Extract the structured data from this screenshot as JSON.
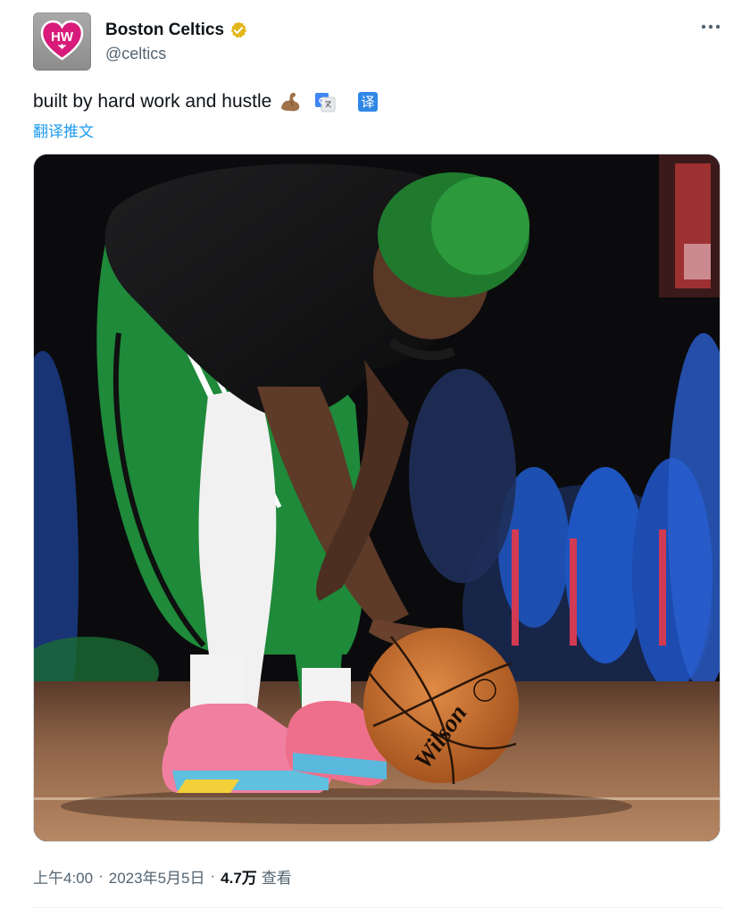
{
  "author": {
    "display_name": "Boston Celtics",
    "handle": "@celtics",
    "avatar_text": "HW",
    "verified_color": "#e2b719"
  },
  "tweet": {
    "text": "built by hard work and hustle",
    "emoji": "flexed-biceps",
    "translate_link": "翻译推文"
  },
  "meta": {
    "time": "上午4:00",
    "separator": "·",
    "date": "2023年5月5日",
    "views_count": "4.7万",
    "views_label": "查看"
  },
  "media": {
    "alt": "Basketball player in green hair and black shirt bending over a Wilson basketball on court",
    "ball_brand": "Wilson"
  },
  "colors": {
    "link": "#1d9bf0",
    "secondary_text": "#536471",
    "avatar_pink": "#d81b7a",
    "celtics_green": "#1e8a3a"
  },
  "icons": {
    "more": "more-dots-icon",
    "verified": "verified-badge-icon",
    "translate_google": "google-translate-icon",
    "translate_yi": "translate-yi-icon"
  }
}
